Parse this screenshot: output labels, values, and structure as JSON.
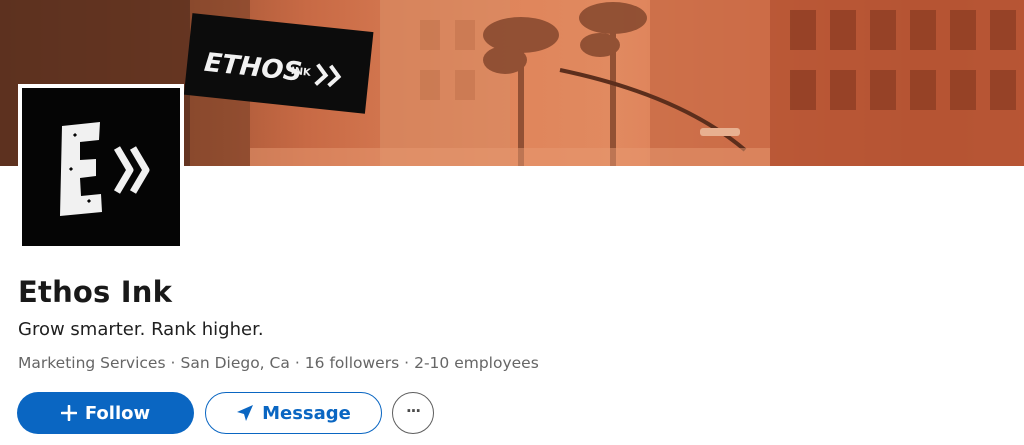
{
  "company": {
    "name": "Ethos Ink",
    "tagline": "Grow smarter. Rank higher.",
    "industry": "Marketing Services",
    "location": "San Diego, Ca",
    "followers": "16 followers",
    "employees": "2-10 employees",
    "meta_separator": "·"
  },
  "cover": {
    "sign_text": "ETHOS",
    "sign_small_text": "INK"
  },
  "actions": {
    "follow_label": "Follow",
    "message_label": "Message",
    "more_label": "···"
  },
  "colors": {
    "primary": "#0a66c2",
    "cover_tone": "#df845a",
    "logo_bg": "#050505"
  },
  "icons": {
    "follow": "plus-icon",
    "message": "send-icon",
    "more": "more-options-icon"
  }
}
